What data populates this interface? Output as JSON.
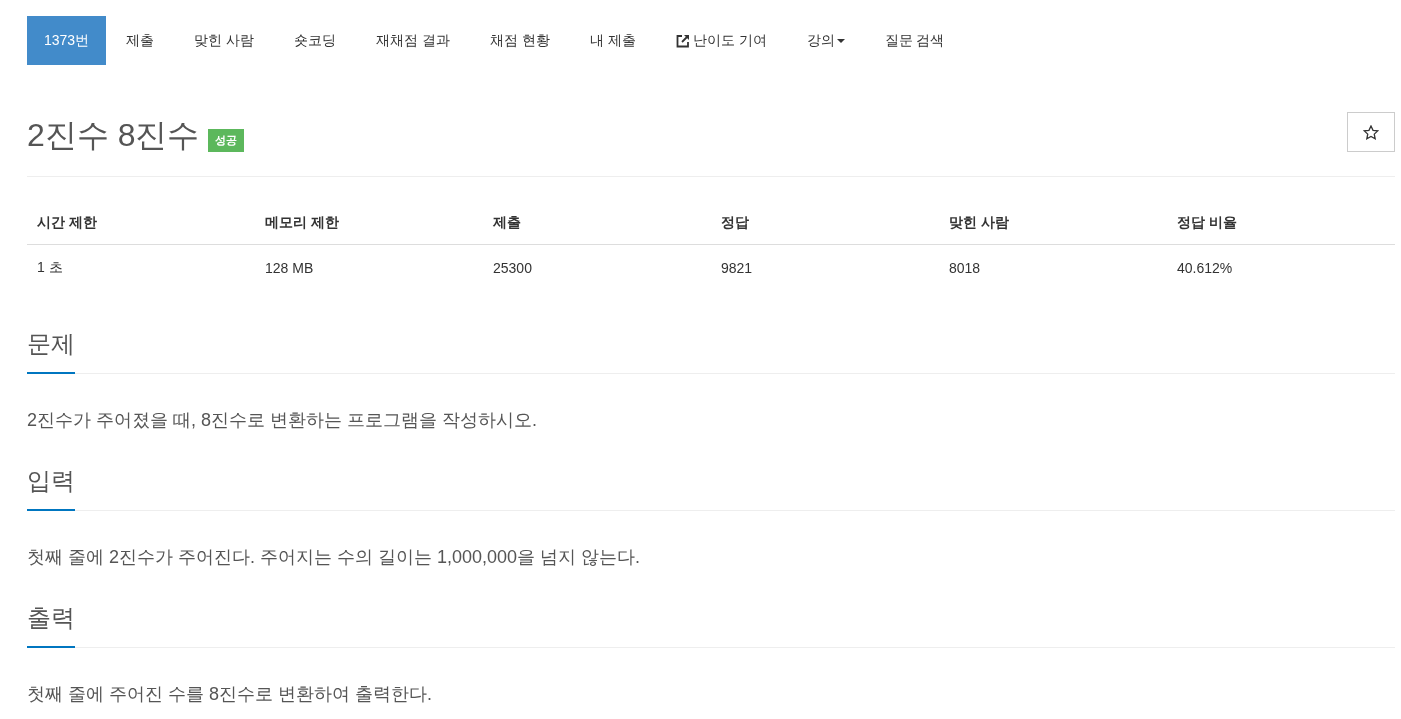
{
  "nav": {
    "items": [
      {
        "label": "1373번",
        "kind": "plain",
        "selected": true
      },
      {
        "label": "제출",
        "kind": "plain",
        "selected": false
      },
      {
        "label": "맞힌 사람",
        "kind": "plain",
        "selected": false
      },
      {
        "label": "숏코딩",
        "kind": "plain",
        "selected": false
      },
      {
        "label": "재채점 결과",
        "kind": "plain",
        "selected": false
      },
      {
        "label": "채점 현황",
        "kind": "plain",
        "selected": false
      },
      {
        "label": "내 제출",
        "kind": "plain",
        "selected": false
      },
      {
        "label": "난이도 기여",
        "kind": "external",
        "selected": false
      },
      {
        "label": "강의",
        "kind": "dropdown",
        "selected": false
      },
      {
        "label": "질문 검색",
        "kind": "plain",
        "selected": false
      }
    ]
  },
  "problem": {
    "title": "2진수 8진수",
    "result_badge": "성공"
  },
  "info_table": {
    "columns": [
      "시간 제한",
      "메모리 제한",
      "제출",
      "정답",
      "맞힌 사람",
      "정답 비율"
    ],
    "rows": [
      [
        "1 초",
        "128 MB",
        "25300",
        "9821",
        "8018",
        "40.612%"
      ]
    ]
  },
  "sections": [
    {
      "heading": "문제",
      "body": "2진수가 주어졌을 때, 8진수로 변환하는 프로그램을 작성하시오."
    },
    {
      "heading": "입력",
      "body": "첫째 줄에 2진수가 주어진다. 주어지는 수의 길이는 1,000,000을 넘지 않는다."
    },
    {
      "heading": "출력",
      "body": "첫째 줄에 주어진 수를 8진수로 변환하여 출력한다."
    }
  ]
}
